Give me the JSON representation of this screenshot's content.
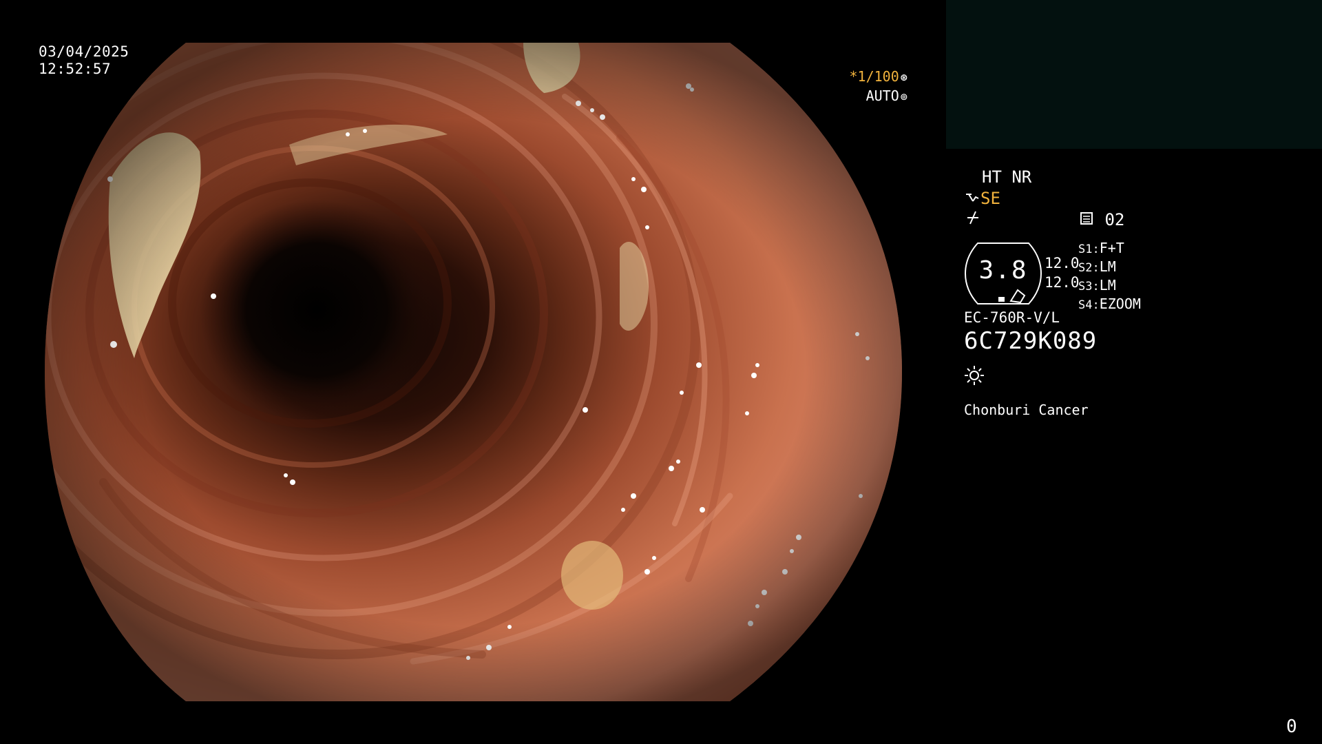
{
  "overlay": {
    "date": "03/04/2025",
    "time": "12:52:57",
    "shutter_value": "*1/100",
    "shutter_icon": "shutter-icon",
    "auto_label": "AUTO",
    "auto_icon": "iris-icon"
  },
  "panel": {
    "mode_label": "HT NR",
    "se_label": "SE",
    "se_icon": "enhancement-icon",
    "freeze_icon": "freeze-icon",
    "memory_icon": "memory-icon",
    "memory_value": "02",
    "gauge_value": "3.8",
    "values": [
      "12.0",
      "12.0"
    ],
    "switches": [
      {
        "key": "S1:",
        "value": "F+T"
      },
      {
        "key": "S2:",
        "value": "LM"
      },
      {
        "key": "S3:",
        "value": "LM"
      },
      {
        "key": "S4:",
        "value": "EZOOM"
      }
    ],
    "scope_model": "EC-760R-V/L",
    "serial_number": "6C729K089",
    "light_icon": "sun-icon",
    "institution": "Chonburi Cancer"
  },
  "footer": {
    "counter": "0"
  }
}
